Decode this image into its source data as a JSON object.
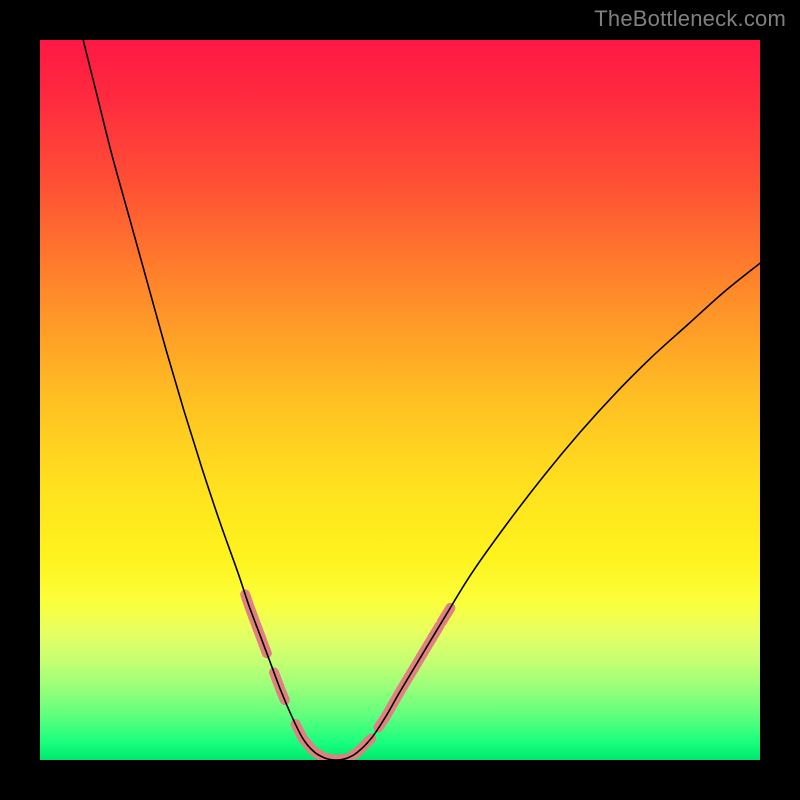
{
  "attribution": "TheBottleneck.com",
  "gradient": {
    "stops": [
      {
        "offset": 0.0,
        "color": "#ff1844"
      },
      {
        "offset": 0.08,
        "color": "#ff2a3f"
      },
      {
        "offset": 0.2,
        "color": "#ff5034"
      },
      {
        "offset": 0.35,
        "color": "#ff8a2a"
      },
      {
        "offset": 0.5,
        "color": "#ffc022"
      },
      {
        "offset": 0.62,
        "color": "#ffe11e"
      },
      {
        "offset": 0.72,
        "color": "#fff31e"
      },
      {
        "offset": 0.78,
        "color": "#fbff3a"
      },
      {
        "offset": 0.82,
        "color": "#e8ff60"
      },
      {
        "offset": 0.86,
        "color": "#c8ff72"
      },
      {
        "offset": 0.9,
        "color": "#98ff7a"
      },
      {
        "offset": 0.94,
        "color": "#5cff7e"
      },
      {
        "offset": 0.975,
        "color": "#1aff7f"
      },
      {
        "offset": 1.0,
        "color": "#00e86d"
      }
    ]
  },
  "chart_data": {
    "type": "line",
    "title": "",
    "xlabel": "",
    "ylabel": "",
    "x_range": [
      0,
      100
    ],
    "y_range": [
      0,
      100
    ],
    "curve": {
      "name": "bottleneck-curve",
      "color": "#000000",
      "width": 1.6,
      "points": [
        {
          "x": 6.0,
          "y": 100.0
        },
        {
          "x": 8.0,
          "y": 92.0
        },
        {
          "x": 10.0,
          "y": 84.0
        },
        {
          "x": 12.5,
          "y": 75.0
        },
        {
          "x": 15.0,
          "y": 66.0
        },
        {
          "x": 17.5,
          "y": 57.0
        },
        {
          "x": 20.0,
          "y": 48.5
        },
        {
          "x": 22.5,
          "y": 40.5
        },
        {
          "x": 25.0,
          "y": 33.0
        },
        {
          "x": 27.5,
          "y": 26.0
        },
        {
          "x": 29.0,
          "y": 21.5
        },
        {
          "x": 30.5,
          "y": 17.5
        },
        {
          "x": 32.0,
          "y": 13.5
        },
        {
          "x": 33.5,
          "y": 9.5
        },
        {
          "x": 35.0,
          "y": 6.0
        },
        {
          "x": 36.5,
          "y": 3.0
        },
        {
          "x": 38.0,
          "y": 1.2
        },
        {
          "x": 39.5,
          "y": 0.3
        },
        {
          "x": 41.0,
          "y": 0.0
        },
        {
          "x": 42.5,
          "y": 0.2
        },
        {
          "x": 44.0,
          "y": 1.0
        },
        {
          "x": 46.0,
          "y": 3.0
        },
        {
          "x": 48.0,
          "y": 6.0
        },
        {
          "x": 50.0,
          "y": 9.5
        },
        {
          "x": 53.0,
          "y": 14.5
        },
        {
          "x": 56.0,
          "y": 19.5
        },
        {
          "x": 60.0,
          "y": 26.0
        },
        {
          "x": 65.0,
          "y": 33.0
        },
        {
          "x": 70.0,
          "y": 39.5
        },
        {
          "x": 75.0,
          "y": 45.5
        },
        {
          "x": 80.0,
          "y": 51.0
        },
        {
          "x": 85.0,
          "y": 56.0
        },
        {
          "x": 90.0,
          "y": 60.5
        },
        {
          "x": 95.0,
          "y": 65.0
        },
        {
          "x": 100.0,
          "y": 69.0
        }
      ]
    },
    "thick_segments": {
      "color": "#e08080",
      "width": 10,
      "cap": "round",
      "segments": [
        {
          "from_x": 28.5,
          "to_x": 31.5
        },
        {
          "from_x": 32.5,
          "to_x": 34.0
        },
        {
          "from_x": 35.5,
          "to_x": 42.5
        },
        {
          "from_x": 43.5,
          "to_x": 46.0
        },
        {
          "from_x": 47.0,
          "to_x": 55.5
        },
        {
          "from_x": 55.8,
          "to_x": 57.0
        }
      ]
    }
  }
}
